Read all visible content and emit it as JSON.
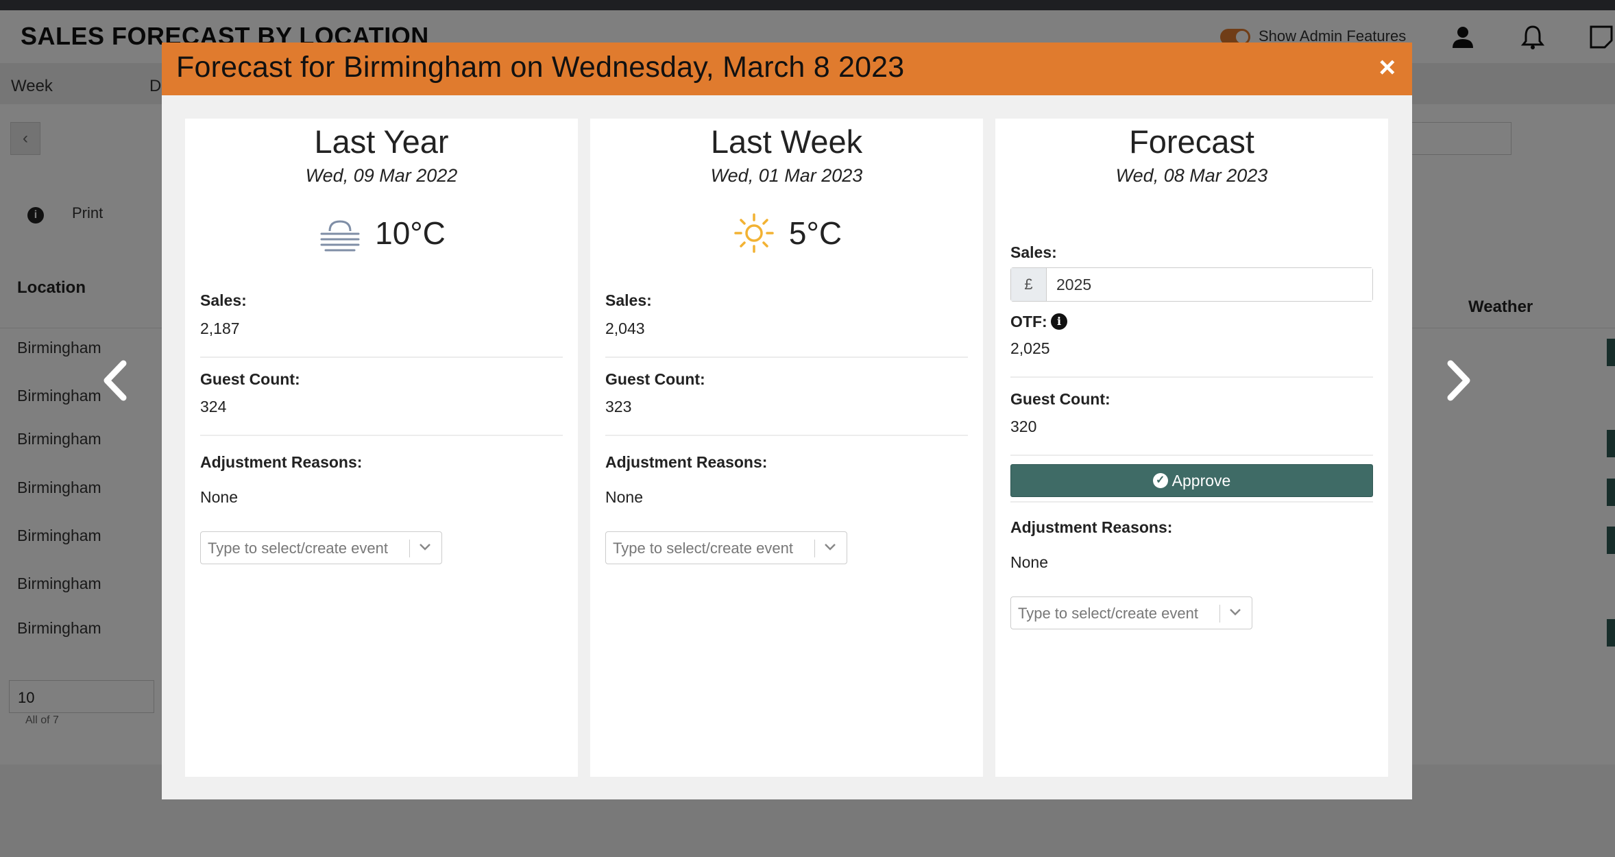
{
  "background": {
    "page_title": "SALES FORECAST BY LOCATION",
    "tabs": [
      "Week",
      "D"
    ],
    "admin_toggle_label": "Show Admin Features",
    "print_label": "Print",
    "location_header": "Location",
    "weather_header": "Weather",
    "rows": [
      "Birmingham",
      "Birmingham",
      "Birmingham",
      "Birmingham",
      "Birmingham",
      "Birmingham",
      "Birmingham"
    ],
    "page_size": "10",
    "page_summary": "All of 7"
  },
  "modal": {
    "title": "Forecast for Birmingham on Wednesday, March 8 2023",
    "close_label": "×",
    "cards": [
      {
        "title": "Last Year",
        "date": "Wed, 09 Mar 2022",
        "weather_icon": "fog-icon",
        "temperature": "10°C",
        "sales_label": "Sales:",
        "sales": "2,187",
        "guest_label": "Guest Count:",
        "guest_count": "324",
        "adjust_label": "Adjustment Reasons:",
        "adjust_value": "None",
        "event_placeholder": "Type to select/create event"
      },
      {
        "title": "Last Week",
        "date": "Wed, 01 Mar 2023",
        "weather_icon": "sun-icon",
        "temperature": "5°C",
        "sales_label": "Sales:",
        "sales": "2,043",
        "guest_label": "Guest Count:",
        "guest_count": "323",
        "adjust_label": "Adjustment Reasons:",
        "adjust_value": "None",
        "event_placeholder": "Type to select/create event"
      },
      {
        "title": "Forecast",
        "date": "Wed, 08 Mar 2023",
        "sales_label": "Sales:",
        "currency_symbol": "£",
        "sales_input": "2025",
        "otf_label": "OTF:",
        "otf_value": "2,025",
        "guest_label": "Guest Count:",
        "guest_count": "320",
        "approve_label": "Approve",
        "adjust_label": "Adjustment Reasons:",
        "adjust_value": "None",
        "event_placeholder": "Type to select/create event"
      }
    ]
  },
  "colors": {
    "header_orange": "#e07b2e",
    "approve_green": "#3f6b66",
    "sun_yellow": "#f2b233",
    "fog_blue": "#7f8ea6"
  }
}
